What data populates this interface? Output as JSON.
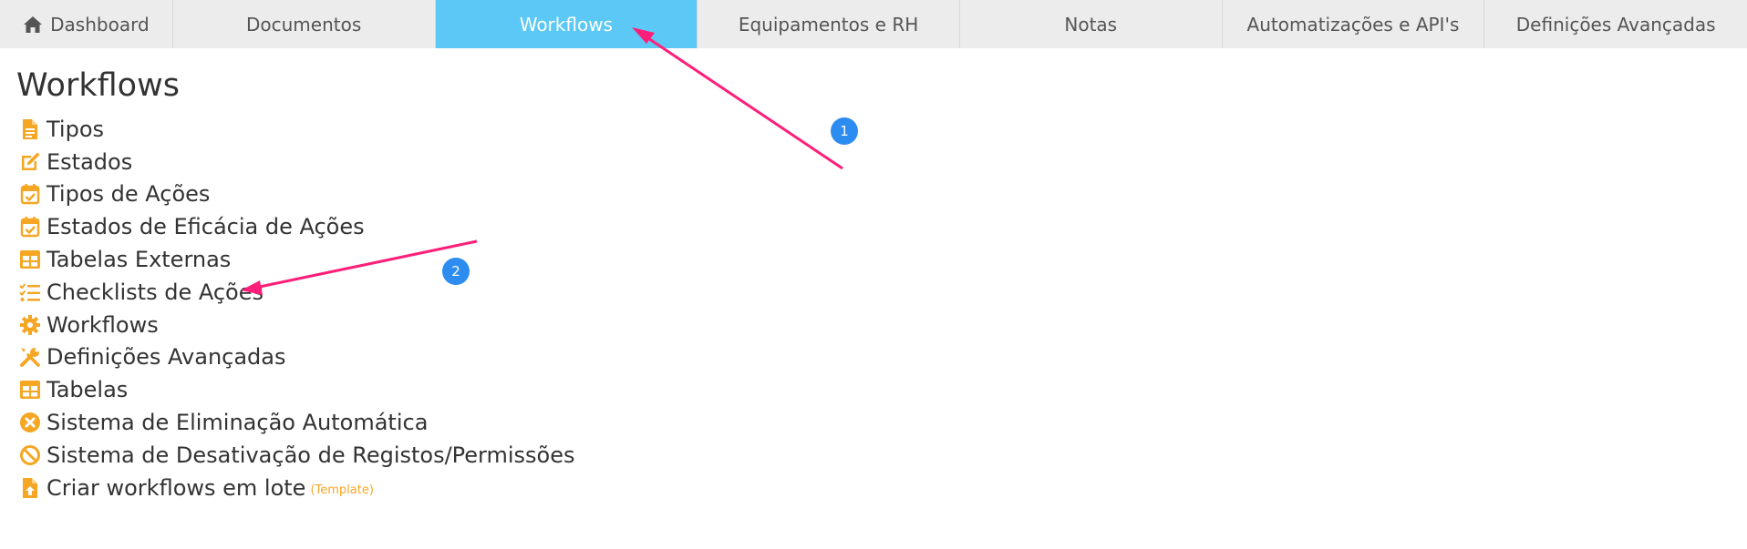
{
  "colors": {
    "active_tab": "#5bc8f5",
    "tab_bg": "#ececec",
    "icon_orange": "#f5a623",
    "arrow": "#ff1f7a",
    "badge": "#2d8cf0"
  },
  "tabs": [
    {
      "label": "Dashboard",
      "icon": "home-icon"
    },
    {
      "label": "Documentos"
    },
    {
      "label": "Workflows",
      "active": true
    },
    {
      "label": "Equipamentos e RH"
    },
    {
      "label": "Notas"
    },
    {
      "label": "Automatizações e API's"
    },
    {
      "label": "Definições Avançadas"
    }
  ],
  "page": {
    "title": "Workflows"
  },
  "menu": [
    {
      "label": "Tipos",
      "icon": "document-icon"
    },
    {
      "label": "Estados",
      "icon": "edit-icon"
    },
    {
      "label": "Tipos de Ações",
      "icon": "calendar-check-icon"
    },
    {
      "label": "Estados de Eficácia de Ações",
      "icon": "calendar-check-icon"
    },
    {
      "label": "Tabelas Externas",
      "icon": "table-icon"
    },
    {
      "label": "Checklists de Ações",
      "icon": "checklist-icon"
    },
    {
      "label": "Workflows",
      "icon": "gear-icon"
    },
    {
      "label": "Definições Avançadas",
      "icon": "tools-icon"
    },
    {
      "label": "Tabelas",
      "icon": "table-icon"
    },
    {
      "label": "Sistema de Eliminação Automática",
      "icon": "times-circle-icon"
    },
    {
      "label": "Sistema de Desativação de Registos/Permissões",
      "icon": "ban-icon"
    },
    {
      "label": "Criar workflows em lote",
      "icon": "file-upload-icon",
      "extra": "(Template)"
    }
  ],
  "annotations": [
    {
      "number": "1"
    },
    {
      "number": "2"
    }
  ]
}
